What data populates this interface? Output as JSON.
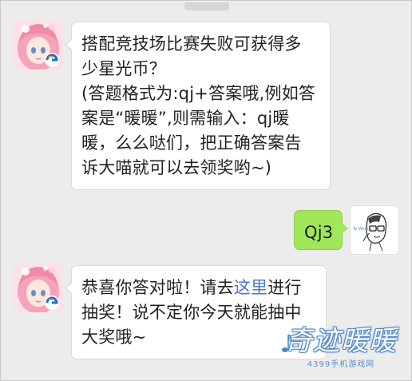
{
  "messages": [
    {
      "side": "left",
      "sender": "qiji-nuannuan-avatar",
      "lines": [
        "搭配竞技场比赛失败可获得多",
        "少星光币？",
        "(答题格式为:qj+答案哦,例如答",
        "案是“暖暖”,则需输入：qj暖",
        "暖，么么哒们，把正确答案告",
        "诉大喵就可以去领奖哟~)"
      ]
    },
    {
      "side": "right",
      "sender": "user-avatar",
      "text": "Qj3",
      "avatar_caption": "To Winnie"
    },
    {
      "side": "left",
      "sender": "qiji-nuannuan-avatar",
      "line1_prefix": "恭喜你答对啦！请去",
      "line1_link": "这里",
      "line1_suffix": "进行",
      "line2": "抽奖！说不定你今天就能抽中",
      "line3": "大奖哦~"
    }
  ],
  "watermark": {
    "logo": "奇迹暖暖",
    "sub": "4399手机游戏网"
  },
  "colors": {
    "background": "#ececec",
    "bubble_left": "#ffffff",
    "bubble_right": "#a0e75a",
    "link": "#4a78c2",
    "watermark": "#4c86c8"
  }
}
